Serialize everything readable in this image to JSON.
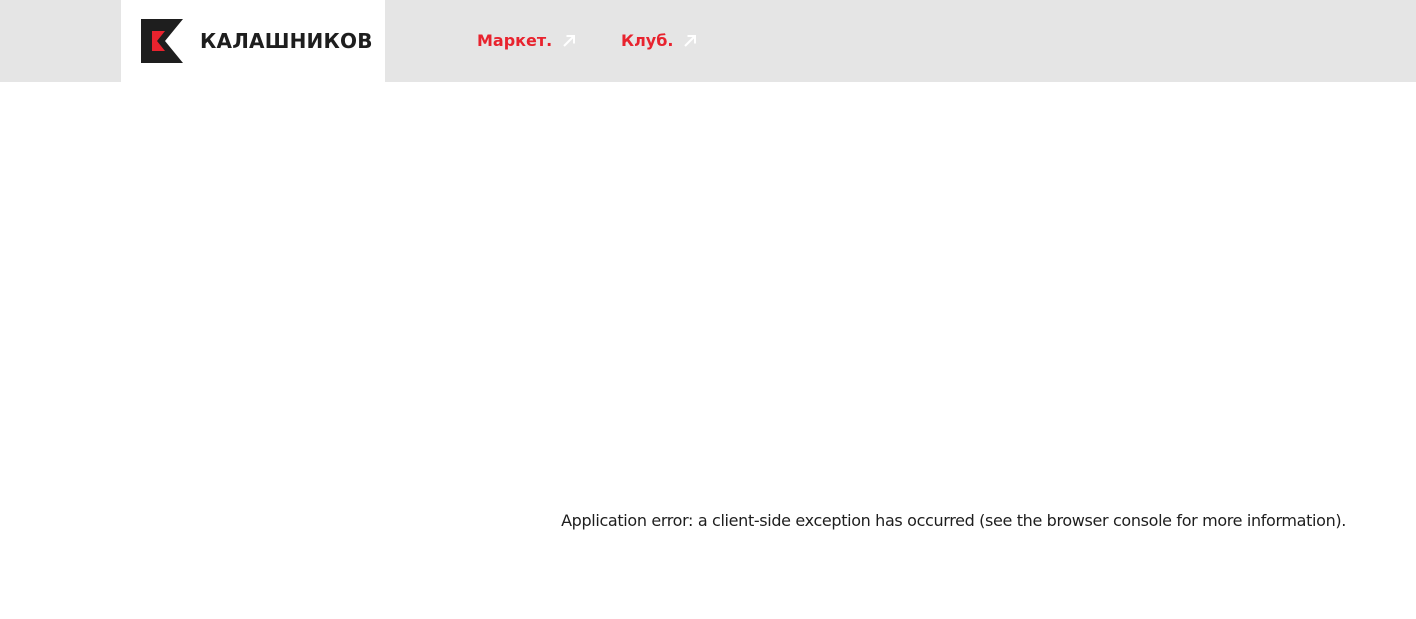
{
  "header": {
    "brand": {
      "name": "КАЛАШНИКОВ",
      "logo_icon": "kalashnikov-k-logo-icon",
      "logo_colors": {
        "dark": "#1e1e1e",
        "accent": "#e8232e"
      }
    },
    "nav": [
      {
        "label": "Маркет.",
        "icon": "external-arrow-icon"
      },
      {
        "label": "Клуб.",
        "icon": "external-arrow-icon"
      }
    ],
    "background": "#e5e5e5",
    "link_color": "#e8232e"
  },
  "main": {
    "error_message": "Application error: a client-side exception has occurred (see the browser console for more information)."
  }
}
